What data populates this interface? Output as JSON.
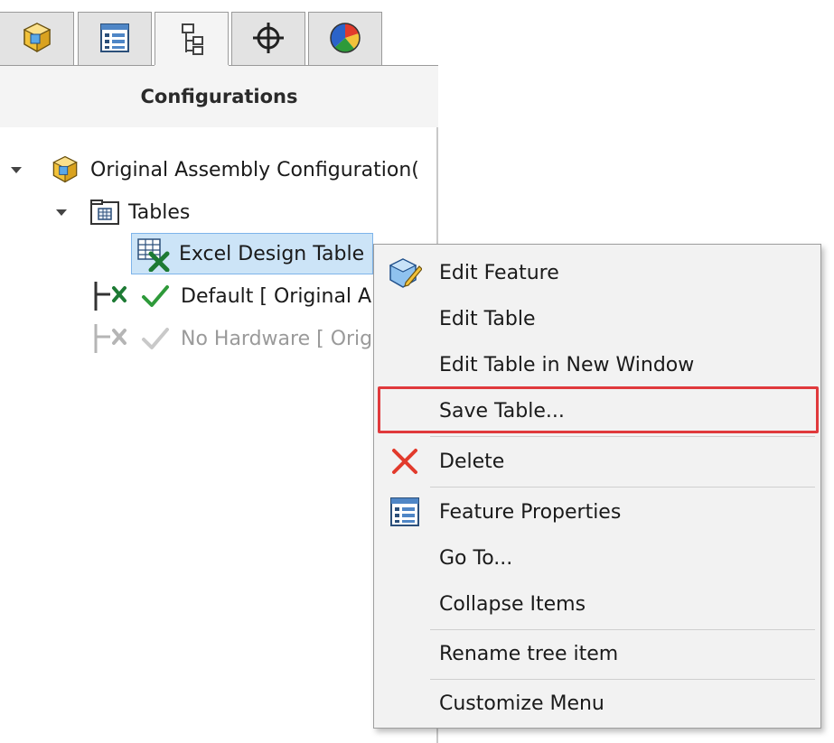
{
  "tabs": [
    {
      "name": "feature-manager-tab",
      "icon": "assembly-icon"
    },
    {
      "name": "property-manager-tab",
      "icon": "property-list-icon"
    },
    {
      "name": "configuration-manager-tab",
      "icon": "configuration-tree-icon",
      "active": true
    },
    {
      "name": "dimxpert-manager-tab",
      "icon": "crosshair-icon"
    },
    {
      "name": "display-manager-tab",
      "icon": "color-wheel-icon"
    }
  ],
  "panel": {
    "title": "Configurations"
  },
  "tree": {
    "root_label": "Original Assembly Configuration(",
    "tables_label": "Tables",
    "design_table_label": "Excel Design Table",
    "config_default_label": "Default [ Original A",
    "config_nohardware_label": "No Hardware [ Orig"
  },
  "context_menu": {
    "items": [
      {
        "label": "Edit Feature",
        "icon": "edit-feature-icon"
      },
      {
        "label": "Edit Table"
      },
      {
        "label": "Edit Table in New Window"
      },
      {
        "label": "Save Table...",
        "highlighted": true
      },
      {
        "label": "Delete",
        "icon": "delete-x-icon"
      },
      {
        "label": "Feature Properties",
        "icon": "properties-icon"
      },
      {
        "label": "Go To..."
      },
      {
        "label": "Collapse Items"
      },
      {
        "label": "Rename tree item"
      },
      {
        "label": "Customize Menu"
      }
    ]
  },
  "colors": {
    "selection": "#cce4f7",
    "highlight_box": "#e0393c",
    "check_green": "#2e9a3a"
  }
}
